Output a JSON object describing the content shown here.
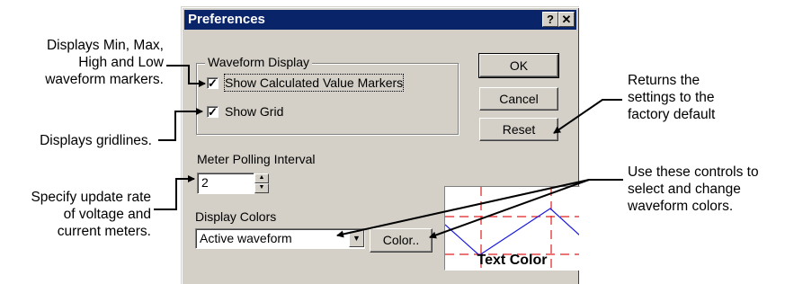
{
  "annotations": {
    "markers": [
      "Displays Min, Max,",
      "High and Low",
      "waveform markers."
    ],
    "gridlines": [
      "Displays gridlines."
    ],
    "polling": [
      "Specify update rate",
      "of voltage and",
      "current meters."
    ],
    "reset": [
      "Returns the",
      "settings to the",
      "factory default"
    ],
    "colors": [
      "Use these controls to",
      "select and change",
      "waveform colors."
    ]
  },
  "dialog": {
    "title": "Preferences",
    "help_glyph": "?",
    "close_glyph": "✕",
    "waveform_display": {
      "label": "Waveform Display",
      "show_markers": {
        "label": "Show Calculated Value Markers",
        "checked": true
      },
      "show_grid": {
        "label": "Show Grid",
        "checked": true
      }
    },
    "buttons": {
      "ok": "OK",
      "cancel": "Cancel",
      "reset": "Reset",
      "color": "Color.."
    },
    "polling": {
      "label": "Meter Polling Interval",
      "value": "2"
    },
    "display_colors": {
      "label": "Display Colors",
      "selected": "Active waveform"
    },
    "preview": {
      "text": "Text Color"
    }
  },
  "colors": {
    "titlebar": "#0a246a",
    "dialog_bg": "#d4d0c8",
    "preview_grid": "#e02020",
    "preview_wave": "#1a1ae0"
  }
}
